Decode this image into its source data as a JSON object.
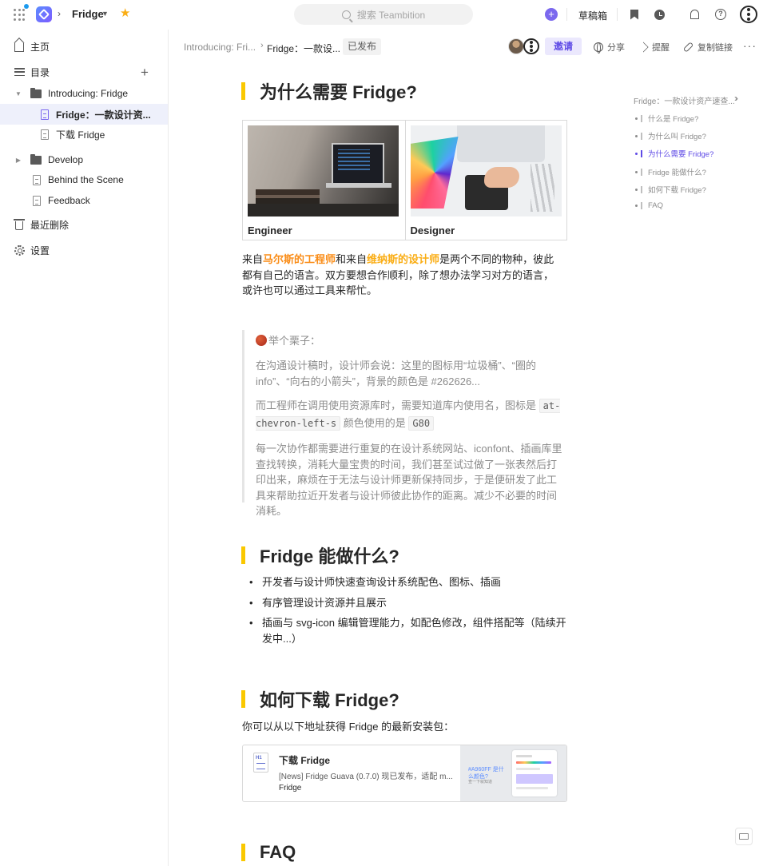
{
  "topbar": {
    "project_name": "Fridge",
    "search_placeholder": "搜索 Teambition",
    "drafts_label": "草稿箱"
  },
  "sidebar": {
    "home_label": "主页",
    "toc_label": "目录",
    "items": [
      {
        "label": "Introducing: Fridge"
      },
      {
        "label": "Fridge：一款设计资..."
      },
      {
        "label": "下载 Fridge"
      },
      {
        "label": "Develop"
      },
      {
        "label": "Behind the Scene"
      },
      {
        "label": "Feedback"
      }
    ],
    "trash_label": "最近删除",
    "settings_label": "设置"
  },
  "doc_header": {
    "crumb_parent": "Introducing: Fri...",
    "crumb_current": "Fridge：一款设...",
    "status": "已发布",
    "invite_label": "邀请",
    "share_label": "分享",
    "remind_label": "提醒",
    "copy_link_label": "复制链接"
  },
  "content": {
    "h_why": "为什么需要 Fridge?",
    "caption_engineer": "Engineer",
    "caption_designer": "Designer",
    "intro": {
      "p1": "来自",
      "mars": "马尔斯的工程师",
      "p2": "和来自",
      "venus": "维纳斯的设计师",
      "p3": "是两个不同的物种，彼此都有自己的语言。双方要想合作顺利，除了想办法学习对方的语言，或许也可以通过工具来帮忙。"
    },
    "quote": {
      "title": "举个栗子：",
      "line1": "在沟通设计稿时，设计师会说：这里的图标用“垃圾桶”、“圈的 info”、“向右的小箭头”，背景的颜色是 #262626...",
      "line2_a": "而工程师在调用使用资源库时，需要知道库内使用名，图标是",
      "code1": "at-chevron-left-s",
      "line2_b": "颜色使用的是",
      "code2": "G80",
      "line3": "每一次协作都需要进行重复的在设计系统网站、iconfont、插画库里查找转换，消耗大量宝贵的时间，我们甚至试过做了一张表然后打印出来，麻烦在于无法与设计师更新保持同步，于是便研发了此工具来帮助拉近开发者与设计师彼此协作的距离。减少不必要的时间消耗。"
    },
    "h_what": "Fridge 能做什么?",
    "bullets": [
      "开发者与设计师快速查询设计系统配色、图标、插画",
      "有序管理设计资源并且展示",
      "插画与 svg-icon 编辑管理能力，如配色修改，组件搭配等（陆续开发中...）"
    ],
    "h_download": "如何下载 Fridge?",
    "download_text": "你可以从以下地址获得 Fridge 的最新安装包：",
    "link_card": {
      "title": "下载 Fridge",
      "desc": "[News] Fridge Guava (0.7.0) 现已发布，适配 m...",
      "source": "Fridge",
      "thumb_text": "#A960FF 是什么颜色?",
      "thumb_sub": "查一下就知道"
    },
    "h_faq": "FAQ"
  },
  "toc": {
    "title": "Fridge：一款设计资产速查...",
    "items": [
      {
        "label": "什么是 Fridge?"
      },
      {
        "label": "为什么叫 Fridge?"
      },
      {
        "label": "为什么需要 Fridge?"
      },
      {
        "label": "Fridge 能做什么?"
      },
      {
        "label": "如何下载 Fridge?"
      },
      {
        "label": "FAQ"
      }
    ],
    "active_index": 2
  },
  "colors": {
    "accent": "#5f4be6",
    "heading_bar": "#fac800",
    "mars_text": "#fa8c16",
    "venus_text": "#faad14"
  }
}
